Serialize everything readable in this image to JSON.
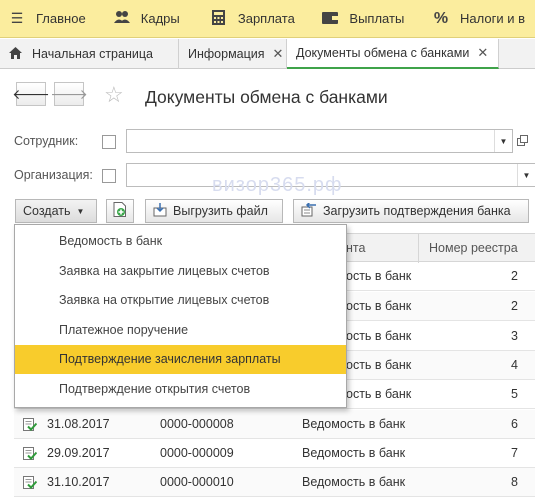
{
  "topbar": {
    "items": [
      {
        "icon": "hamburger-icon",
        "glyph": "☰",
        "label": "Главное"
      },
      {
        "icon": "people-icon",
        "glyph": "👥",
        "label": "Кадры"
      },
      {
        "icon": "calculator-icon",
        "glyph": "▦",
        "label": "Зарплата"
      },
      {
        "icon": "wallet-icon",
        "glyph": "▬",
        "label": "Выплаты"
      },
      {
        "icon": "percent-icon",
        "glyph": "%",
        "label": "Налоги и в"
      }
    ]
  },
  "tabs": [
    {
      "label": "Начальная страница",
      "has_home_icon": true
    },
    {
      "label": "Информация",
      "has_close": true
    },
    {
      "label": "Документы обмена с банками",
      "has_close": true,
      "active": true
    }
  ],
  "header": {
    "title": "Документы обмена с банками"
  },
  "filters": {
    "employee_label": "Сотрудник:",
    "organization_label": "Организация:"
  },
  "watermark": "визор365.рф",
  "toolbar": {
    "create_label": "Создать",
    "unload_label": "Выгрузить файл",
    "load_label": "Загрузить подтверждения банка"
  },
  "table": {
    "columns": [
      "нта",
      "Номер реестра"
    ],
    "rows": [
      {
        "date": "",
        "number": "",
        "type": "ость в банк",
        "registry": "2"
      },
      {
        "date": "",
        "number": "",
        "type": "ость в банк",
        "registry": "2"
      },
      {
        "date": "",
        "number": "",
        "type": "ость в банк",
        "registry": "3"
      },
      {
        "date": "",
        "number": "",
        "type": "ость в банк",
        "registry": "4"
      },
      {
        "date": "",
        "number": "",
        "type": "ость в банк",
        "registry": "5"
      },
      {
        "date": "31.08.2017",
        "number": "0000-000008",
        "type": "Ведомость в банк",
        "registry": "6"
      },
      {
        "date": "29.09.2017",
        "number": "0000-000009",
        "type": "Ведомость в банк",
        "registry": "7"
      },
      {
        "date": "31.10.2017",
        "number": "0000-000010",
        "type": "Ведомость в банк",
        "registry": "8"
      }
    ]
  },
  "create_menu": {
    "items": [
      {
        "label": "Ведомость в банк"
      },
      {
        "label": "Заявка на закрытие лицевых счетов"
      },
      {
        "label": "Заявка на открытие лицевых счетов"
      },
      {
        "label": "Платежное поручение"
      },
      {
        "label": "Подтверждение зачисления зарплаты",
        "selected": true
      },
      {
        "label": "Подтверждение открытия счетов"
      }
    ]
  },
  "colors": {
    "topbar": "#fbed9e",
    "highlight": "#f8cc2c",
    "active_tab_underline": "#3fa34a"
  }
}
